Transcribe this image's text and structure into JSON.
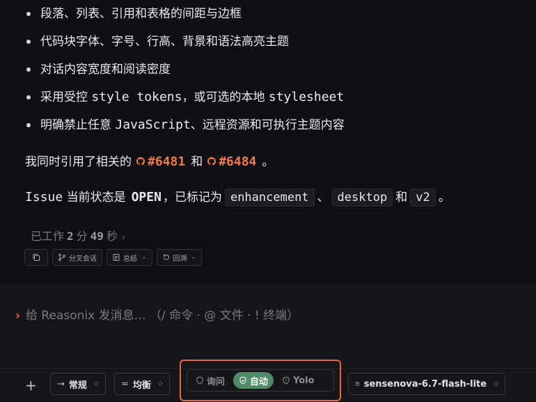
{
  "bullets": [
    {
      "text": "段落、列表、引用和表格的间距与边框"
    },
    {
      "text": "代码块字体、字号、行高、背景和语法高亮主题"
    },
    {
      "text": "对话内容宽度和阅读密度"
    },
    {
      "pre": "采用受控 ",
      "code1": "style tokens",
      "mid": "，或可选的本地 ",
      "code2": "stylesheet"
    },
    {
      "pre": "明确禁止任意 ",
      "code1": "JavaScript",
      "post": "、远程资源和可执行主题内容"
    }
  ],
  "para1": {
    "pre": "我同时引用了相关的",
    "ref1": "#6481",
    "mid": "和",
    "ref2": "#6484",
    "post": "。"
  },
  "para2": {
    "label": "Issue",
    "pre": " 当前状态是",
    "state": "OPEN",
    "mid": "，已标记为",
    "tag1": "enhancement",
    "sep1": "、",
    "tag2": "desktop",
    "and": "和",
    "tag3": "v2",
    "post": "。"
  },
  "worked": {
    "pre": "已工作",
    "minutes": "2",
    "min_unit": "分",
    "seconds": "49",
    "sec_unit": "秒",
    "chevron": "›"
  },
  "actions": {
    "fork": "分叉会话",
    "summary": "总结",
    "rewind": "回溯"
  },
  "composer": {
    "placeholder": "给 Reasonix 发消息… （/ 命令 · @ 文件 · ! 终端）"
  },
  "toolbar": {
    "plus": "+",
    "style_label": "常规",
    "balance_label": "均衡",
    "modes": {
      "ask": "询问",
      "auto": "自动",
      "yolo": "Yolo"
    },
    "model": "sensenova-6.7-flash-lite"
  },
  "colors": {
    "accent": "#e8673c",
    "ref": "#f07a4a",
    "auto_active": "#4f8b64",
    "bg": "#0f0e12"
  }
}
